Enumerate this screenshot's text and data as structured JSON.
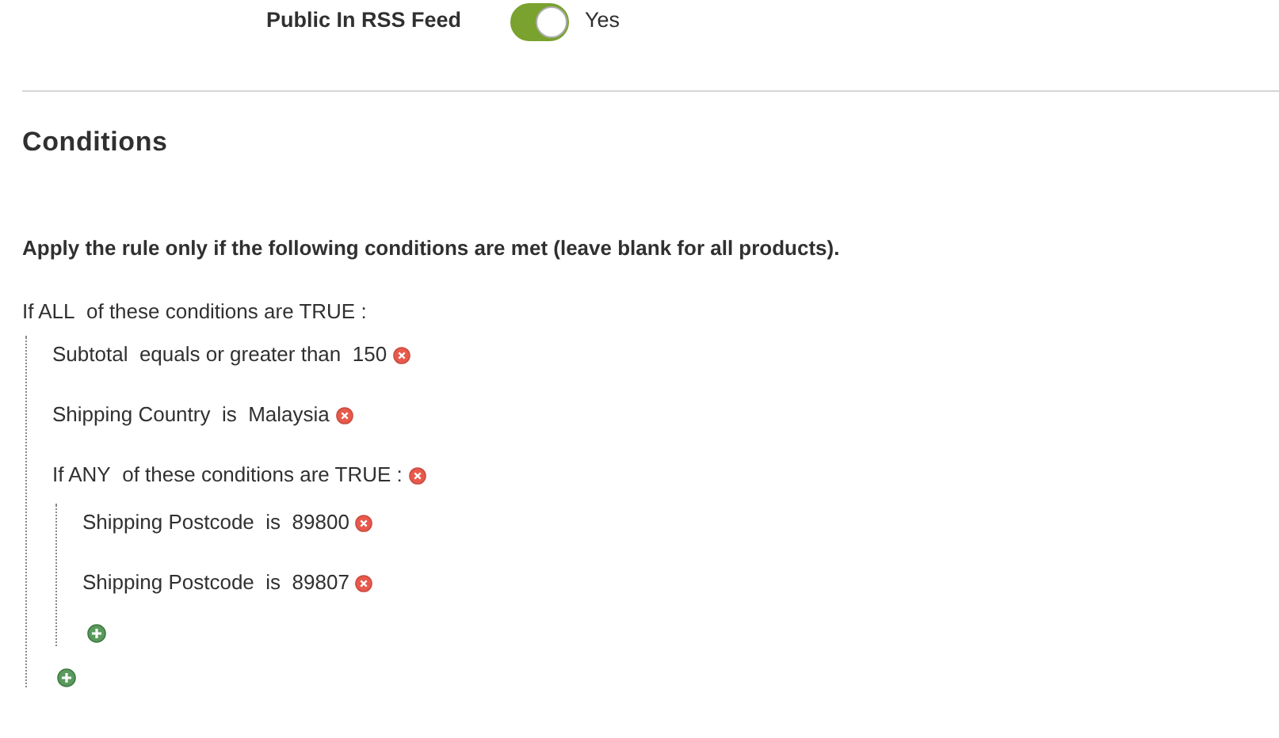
{
  "rss_field": {
    "label": "Public In RSS Feed",
    "on": true,
    "value_label": "Yes"
  },
  "section": {
    "title": "Conditions",
    "intro": "Apply the rule only if the following conditions are met (leave blank for all products).",
    "conditions": {
      "kind": "combine",
      "prefix": "If",
      "aggregator": "ALL",
      "middle": "of these conditions are",
      "value": "TRUE",
      "suffix": ":",
      "children": [
        {
          "kind": "condition",
          "attribute": "Subtotal",
          "operator": "equals or greater than",
          "value": "150"
        },
        {
          "kind": "condition",
          "attribute": "Shipping Country",
          "operator": "is",
          "value": "Malaysia"
        },
        {
          "kind": "combine",
          "prefix": "If",
          "aggregator": "ANY",
          "middle": "of these conditions are",
          "value": "TRUE",
          "suffix": ":",
          "children": [
            {
              "kind": "condition",
              "attribute": "Shipping Postcode",
              "operator": "is",
              "value": "89800"
            },
            {
              "kind": "condition",
              "attribute": "Shipping Postcode",
              "operator": "is",
              "value": "89807"
            }
          ]
        }
      ]
    }
  }
}
